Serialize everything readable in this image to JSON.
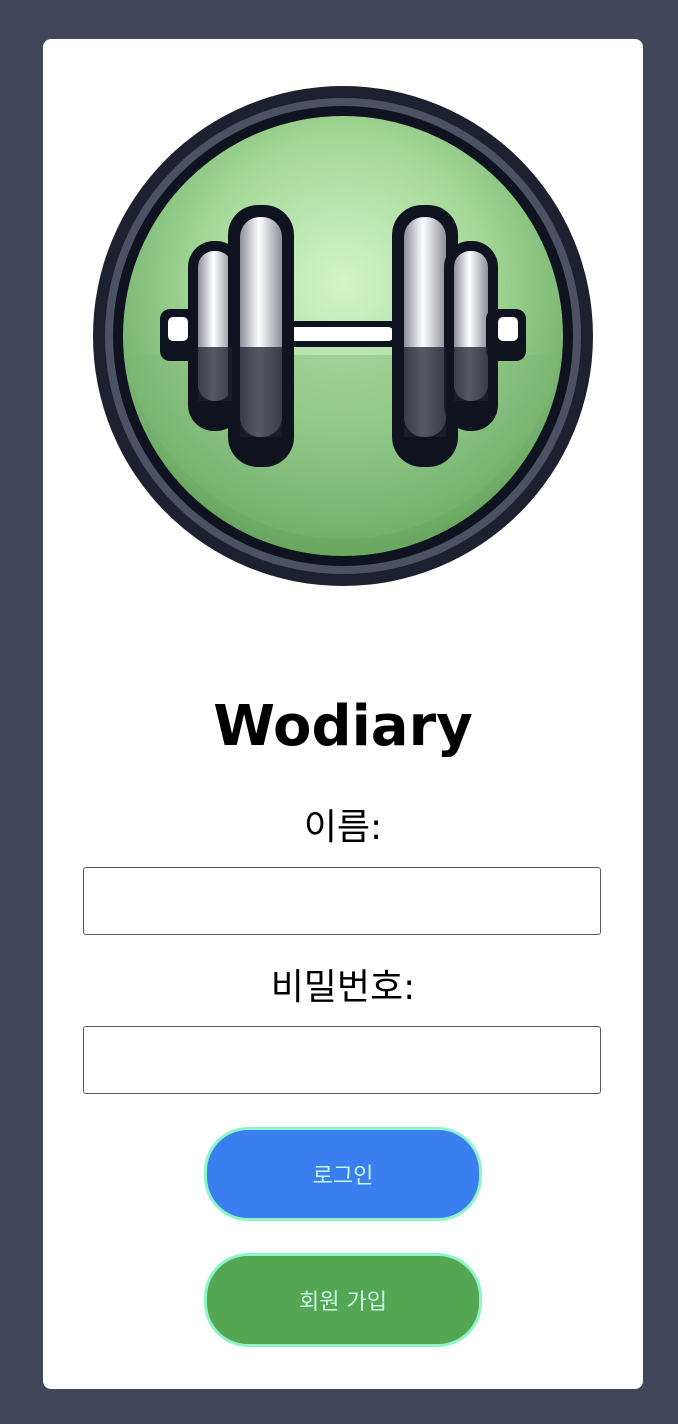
{
  "app": {
    "title": "Wodiary"
  },
  "logo": {
    "icon": "dumbbell-icon"
  },
  "form": {
    "name_label": "이름:",
    "name_value": "",
    "password_label": "비밀번호:",
    "password_value": ""
  },
  "buttons": {
    "login_label": "로그인",
    "signup_label": "회원 가입"
  },
  "colors": {
    "page_background": "#3f4759",
    "card_background": "#ffffff",
    "login_button": "#3b7ef0",
    "signup_button": "#54a653",
    "button_border": "#8ef5c8",
    "button_text": "#c8f8e8",
    "logo_green": "#a8dda0"
  }
}
